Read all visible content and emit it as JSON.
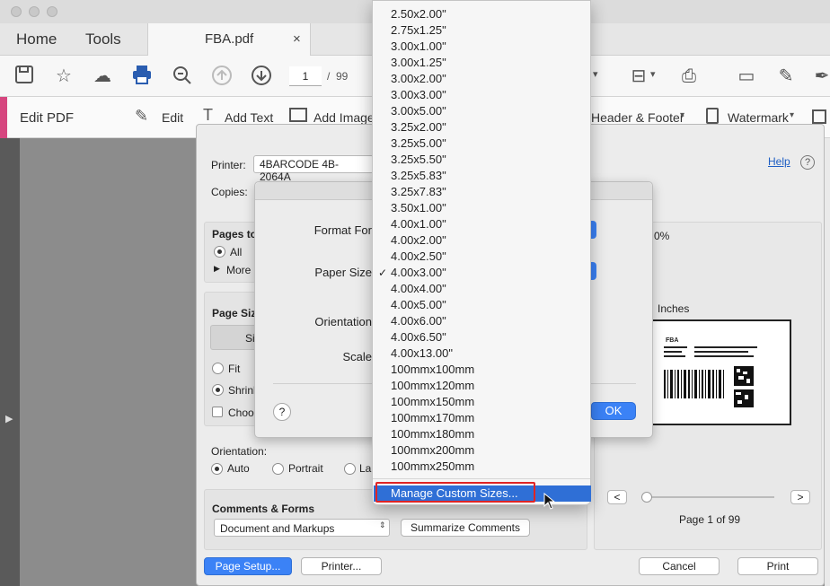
{
  "app": {
    "tabs": {
      "home": "Home",
      "tools": "Tools",
      "file": "FBA.pdf",
      "close": "×"
    },
    "toolbar": {
      "page_current": "1",
      "page_sep": "/",
      "page_total": "99"
    },
    "editbar": {
      "title": "Edit PDF",
      "edit": "Edit",
      "add_text": "Add Text",
      "add_image": "Add Image",
      "header_footer": "Header & Footer",
      "watermark": "Watermark"
    }
  },
  "print_dialog": {
    "printer_label": "Printer:",
    "printer_value": "4BARCODE 4B-2064A",
    "help": "Help",
    "copies_label": "Copies:",
    "pages_label": "Pages to",
    "pages_all": "All",
    "pages_more": "More",
    "page_sizing_label": "Page Siz",
    "size_tab": "Si",
    "fit": "Fit",
    "shrink": "Shrink",
    "choose": "Choos",
    "orientation_label": "Orientation:",
    "auto": "Auto",
    "portrait": "Portrait",
    "landscape": "La",
    "comments_label": "Comments & Forms",
    "comments_value": "Document and Markups",
    "summarize": "Summarize Comments",
    "page_setup": "Page Setup...",
    "printer_btn": "Printer...",
    "cancel": "Cancel",
    "print": "Print",
    "scale_readout": "0%",
    "size_readout": "Inches",
    "page_of": "Page 1 of 99",
    "prev": "<",
    "next": ">"
  },
  "page_setup": {
    "format_for": "Format For",
    "paper_size": "Paper Size",
    "orientation": "Orientation",
    "scale": "Scale",
    "help": "?",
    "ok": "OK"
  },
  "paper_menu": {
    "items": [
      "2.50x2.00\"",
      "2.75x1.25\"",
      "3.00x1.00\"",
      "3.00x1.25\"",
      "3.00x2.00\"",
      "3.00x3.00\"",
      "3.00x5.00\"",
      "3.25x2.00\"",
      "3.25x5.00\"",
      "3.25x5.50\"",
      "3.25x5.83\"",
      "3.25x7.83\"",
      "3.50x1.00\"",
      "4.00x1.00\"",
      "4.00x2.00\"",
      "4.00x2.50\"",
      "4.00x3.00\"",
      "4.00x4.00\"",
      "4.00x5.00\"",
      "4.00x6.00\"",
      "4.00x6.50\"",
      "4.00x13.00\"",
      "100mmx100mm",
      "100mmx120mm",
      "100mmx150mm",
      "100mmx170mm",
      "100mmx180mm",
      "100mmx200mm",
      "100mmx250mm"
    ],
    "checked": "✓",
    "manage": "Manage Custom Sizes..."
  },
  "preview": {
    "label": "FBA"
  },
  "colors": {
    "accent": "#d6467f",
    "selection": "#2f6fd6",
    "highlight": "#e02424"
  }
}
